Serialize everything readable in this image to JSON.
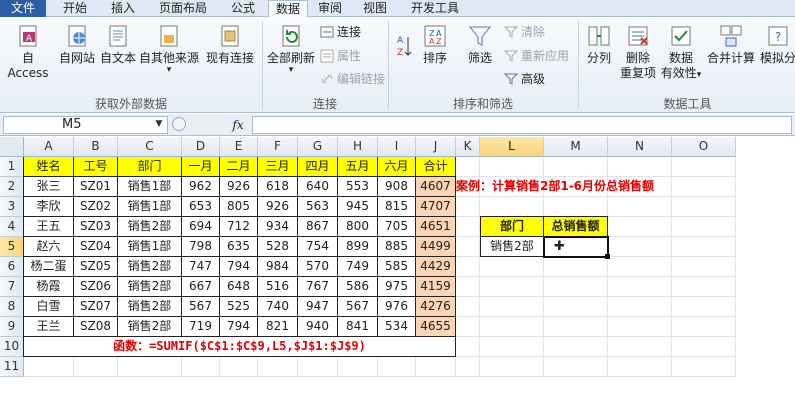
{
  "tabs": [
    "文件",
    "开始",
    "插入",
    "页面布局",
    "公式",
    "数据",
    "审阅",
    "视图",
    "开发工具"
  ],
  "ribbon": {
    "get_external": [
      "自 Access",
      "自网站",
      "自文本",
      "自其他来源",
      "现有连接"
    ],
    "get_external_group": "获取外部数据",
    "refresh_all": "全部刷新",
    "connections": "连接",
    "properties": "属性",
    "edit_links": "编辑链接",
    "connections_group": "连接",
    "sort_asc_icon": "sort-az-icon",
    "sort": "排序",
    "filter": "筛选",
    "clear": "清除",
    "reapply": "重新应用",
    "advanced": "高级",
    "sort_filter_group": "排序和筛选",
    "text_to_columns": "分列",
    "remove_dup_l1": "删除",
    "remove_dup_l2": "重复项",
    "data_valid_l1": "数据",
    "data_valid_l2": "有效性",
    "consolidate": "合并计算",
    "whatif": "模拟分",
    "data_tools_group": "数据工具"
  },
  "formula_bar": {
    "name_box": "M5",
    "fx": "fx",
    "formula": ""
  },
  "columns": [
    "A",
    "B",
    "C",
    "D",
    "E",
    "F",
    "G",
    "H",
    "I",
    "J",
    "K",
    "L",
    "M",
    "N",
    "O"
  ],
  "rows": [
    "1",
    "2",
    "3",
    "4",
    "5",
    "6",
    "7",
    "8",
    "9",
    "10",
    "11"
  ],
  "table": {
    "headers": [
      "姓名",
      "工号",
      "部门",
      "一月",
      "二月",
      "三月",
      "四月",
      "五月",
      "六月",
      "合计"
    ],
    "rows": [
      [
        "张三",
        "SZ01",
        "销售1部",
        "962",
        "926",
        "618",
        "640",
        "553",
        "908",
        "4607"
      ],
      [
        "李欣",
        "SZ02",
        "销售1部",
        "653",
        "805",
        "926",
        "563",
        "945",
        "815",
        "4707"
      ],
      [
        "王五",
        "SZ03",
        "销售2部",
        "694",
        "712",
        "934",
        "867",
        "800",
        "705",
        "4651"
      ],
      [
        "赵六",
        "SZ04",
        "销售1部",
        "798",
        "635",
        "528",
        "754",
        "899",
        "885",
        "4499"
      ],
      [
        "杨二蛋",
        "SZ05",
        "销售2部",
        "747",
        "794",
        "984",
        "570",
        "749",
        "585",
        "4429"
      ],
      [
        "杨霞",
        "SZ06",
        "销售2部",
        "667",
        "648",
        "516",
        "767",
        "586",
        "975",
        "4159"
      ],
      [
        "白雪",
        "SZ07",
        "销售2部",
        "567",
        "525",
        "740",
        "947",
        "567",
        "976",
        "4276"
      ],
      [
        "王兰",
        "SZ08",
        "销售2部",
        "719",
        "794",
        "821",
        "940",
        "841",
        "534",
        "4655"
      ]
    ],
    "formula_note": "函数：=SUMIF($C$1:$C$9,L5,$J$1:$J$9)"
  },
  "case_title": "案例：计算销售2部1-6月份总销售额",
  "lookup": {
    "dept_header": "部门",
    "total_header": "总销售额",
    "dept_value": "销售2部",
    "total_value": ""
  }
}
